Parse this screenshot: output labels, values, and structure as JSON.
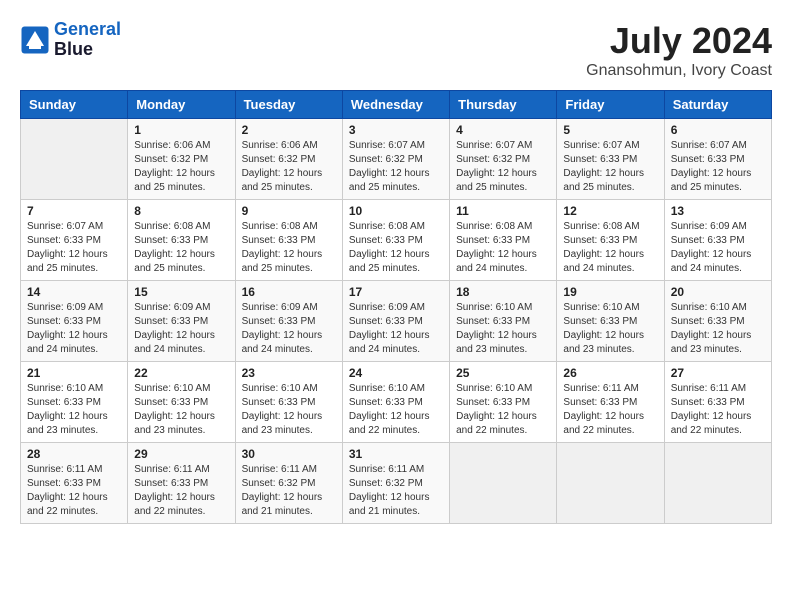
{
  "header": {
    "logo_line1": "General",
    "logo_line2": "Blue",
    "month_year": "July 2024",
    "location": "Gnansohmun, Ivory Coast"
  },
  "weekdays": [
    "Sunday",
    "Monday",
    "Tuesday",
    "Wednesday",
    "Thursday",
    "Friday",
    "Saturday"
  ],
  "weeks": [
    [
      {
        "day": "",
        "sunrise": "",
        "sunset": "",
        "daylight": ""
      },
      {
        "day": "1",
        "sunrise": "Sunrise: 6:06 AM",
        "sunset": "Sunset: 6:32 PM",
        "daylight": "Daylight: 12 hours and 25 minutes."
      },
      {
        "day": "2",
        "sunrise": "Sunrise: 6:06 AM",
        "sunset": "Sunset: 6:32 PM",
        "daylight": "Daylight: 12 hours and 25 minutes."
      },
      {
        "day": "3",
        "sunrise": "Sunrise: 6:07 AM",
        "sunset": "Sunset: 6:32 PM",
        "daylight": "Daylight: 12 hours and 25 minutes."
      },
      {
        "day": "4",
        "sunrise": "Sunrise: 6:07 AM",
        "sunset": "Sunset: 6:32 PM",
        "daylight": "Daylight: 12 hours and 25 minutes."
      },
      {
        "day": "5",
        "sunrise": "Sunrise: 6:07 AM",
        "sunset": "Sunset: 6:33 PM",
        "daylight": "Daylight: 12 hours and 25 minutes."
      },
      {
        "day": "6",
        "sunrise": "Sunrise: 6:07 AM",
        "sunset": "Sunset: 6:33 PM",
        "daylight": "Daylight: 12 hours and 25 minutes."
      }
    ],
    [
      {
        "day": "7",
        "sunrise": "Sunrise: 6:07 AM",
        "sunset": "Sunset: 6:33 PM",
        "daylight": "Daylight: 12 hours and 25 minutes."
      },
      {
        "day": "8",
        "sunrise": "Sunrise: 6:08 AM",
        "sunset": "Sunset: 6:33 PM",
        "daylight": "Daylight: 12 hours and 25 minutes."
      },
      {
        "day": "9",
        "sunrise": "Sunrise: 6:08 AM",
        "sunset": "Sunset: 6:33 PM",
        "daylight": "Daylight: 12 hours and 25 minutes."
      },
      {
        "day": "10",
        "sunrise": "Sunrise: 6:08 AM",
        "sunset": "Sunset: 6:33 PM",
        "daylight": "Daylight: 12 hours and 25 minutes."
      },
      {
        "day": "11",
        "sunrise": "Sunrise: 6:08 AM",
        "sunset": "Sunset: 6:33 PM",
        "daylight": "Daylight: 12 hours and 24 minutes."
      },
      {
        "day": "12",
        "sunrise": "Sunrise: 6:08 AM",
        "sunset": "Sunset: 6:33 PM",
        "daylight": "Daylight: 12 hours and 24 minutes."
      },
      {
        "day": "13",
        "sunrise": "Sunrise: 6:09 AM",
        "sunset": "Sunset: 6:33 PM",
        "daylight": "Daylight: 12 hours and 24 minutes."
      }
    ],
    [
      {
        "day": "14",
        "sunrise": "Sunrise: 6:09 AM",
        "sunset": "Sunset: 6:33 PM",
        "daylight": "Daylight: 12 hours and 24 minutes."
      },
      {
        "day": "15",
        "sunrise": "Sunrise: 6:09 AM",
        "sunset": "Sunset: 6:33 PM",
        "daylight": "Daylight: 12 hours and 24 minutes."
      },
      {
        "day": "16",
        "sunrise": "Sunrise: 6:09 AM",
        "sunset": "Sunset: 6:33 PM",
        "daylight": "Daylight: 12 hours and 24 minutes."
      },
      {
        "day": "17",
        "sunrise": "Sunrise: 6:09 AM",
        "sunset": "Sunset: 6:33 PM",
        "daylight": "Daylight: 12 hours and 24 minutes."
      },
      {
        "day": "18",
        "sunrise": "Sunrise: 6:10 AM",
        "sunset": "Sunset: 6:33 PM",
        "daylight": "Daylight: 12 hours and 23 minutes."
      },
      {
        "day": "19",
        "sunrise": "Sunrise: 6:10 AM",
        "sunset": "Sunset: 6:33 PM",
        "daylight": "Daylight: 12 hours and 23 minutes."
      },
      {
        "day": "20",
        "sunrise": "Sunrise: 6:10 AM",
        "sunset": "Sunset: 6:33 PM",
        "daylight": "Daylight: 12 hours and 23 minutes."
      }
    ],
    [
      {
        "day": "21",
        "sunrise": "Sunrise: 6:10 AM",
        "sunset": "Sunset: 6:33 PM",
        "daylight": "Daylight: 12 hours and 23 minutes."
      },
      {
        "day": "22",
        "sunrise": "Sunrise: 6:10 AM",
        "sunset": "Sunset: 6:33 PM",
        "daylight": "Daylight: 12 hours and 23 minutes."
      },
      {
        "day": "23",
        "sunrise": "Sunrise: 6:10 AM",
        "sunset": "Sunset: 6:33 PM",
        "daylight": "Daylight: 12 hours and 23 minutes."
      },
      {
        "day": "24",
        "sunrise": "Sunrise: 6:10 AM",
        "sunset": "Sunset: 6:33 PM",
        "daylight": "Daylight: 12 hours and 22 minutes."
      },
      {
        "day": "25",
        "sunrise": "Sunrise: 6:10 AM",
        "sunset": "Sunset: 6:33 PM",
        "daylight": "Daylight: 12 hours and 22 minutes."
      },
      {
        "day": "26",
        "sunrise": "Sunrise: 6:11 AM",
        "sunset": "Sunset: 6:33 PM",
        "daylight": "Daylight: 12 hours and 22 minutes."
      },
      {
        "day": "27",
        "sunrise": "Sunrise: 6:11 AM",
        "sunset": "Sunset: 6:33 PM",
        "daylight": "Daylight: 12 hours and 22 minutes."
      }
    ],
    [
      {
        "day": "28",
        "sunrise": "Sunrise: 6:11 AM",
        "sunset": "Sunset: 6:33 PM",
        "daylight": "Daylight: 12 hours and 22 minutes."
      },
      {
        "day": "29",
        "sunrise": "Sunrise: 6:11 AM",
        "sunset": "Sunset: 6:33 PM",
        "daylight": "Daylight: 12 hours and 22 minutes."
      },
      {
        "day": "30",
        "sunrise": "Sunrise: 6:11 AM",
        "sunset": "Sunset: 6:32 PM",
        "daylight": "Daylight: 12 hours and 21 minutes."
      },
      {
        "day": "31",
        "sunrise": "Sunrise: 6:11 AM",
        "sunset": "Sunset: 6:32 PM",
        "daylight": "Daylight: 12 hours and 21 minutes."
      },
      {
        "day": "",
        "sunrise": "",
        "sunset": "",
        "daylight": ""
      },
      {
        "day": "",
        "sunrise": "",
        "sunset": "",
        "daylight": ""
      },
      {
        "day": "",
        "sunrise": "",
        "sunset": "",
        "daylight": ""
      }
    ]
  ]
}
